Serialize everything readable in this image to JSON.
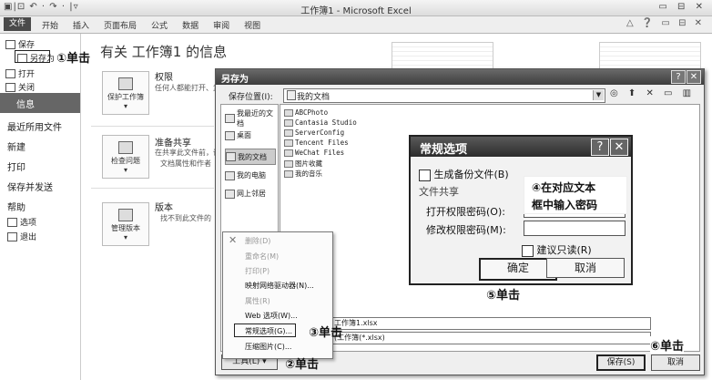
{
  "window": {
    "title": "工作簿1 - Microsoft Excel",
    "qat": "▣|⊡ ↶ · ↷ · |▿",
    "controls": "▭ ⊟ ✕"
  },
  "ribbon": {
    "file_tab": "文件",
    "tabs": [
      "开始",
      "插入",
      "页面布局",
      "公式",
      "数据",
      "审阅",
      "视图"
    ],
    "right_icons": "△ ❓ ▭ ⊟ ✕"
  },
  "backstage": {
    "items": {
      "save": "保存",
      "save_as": "另存为",
      "open": "打开",
      "close": "关闭",
      "info": "信息",
      "recent": "最近所用文件",
      "new": "新建",
      "print": "打印",
      "save_send": "保存并发送",
      "help": "帮助",
      "options": "选项",
      "exit": "退出"
    },
    "info_title": "有关 工作簿1 的信息",
    "sections": [
      {
        "button": "保护工作簿",
        "title": "权限",
        "text": "任何人都能打开、复"
      },
      {
        "button": "检查问题",
        "title": "准备共享",
        "text": "在共享此文件前，请",
        "text2": "文档属性和作者"
      },
      {
        "button": "管理版本",
        "title": "版本",
        "text": "找不到此文件的"
      }
    ]
  },
  "save_as": {
    "title": "另存为",
    "help_btn": "?",
    "close_btn": "✕",
    "location_label": "保存位置(I):",
    "location_value": "我的文档",
    "toolbar_icons": "◎ ⬆ ✕ ▭ ▥",
    "places": [
      "我最近的文档",
      "桌面",
      "我的文档",
      "我的电脑",
      "网上邻居"
    ],
    "files": [
      "ABCPhoto",
      "Cantasia Studio",
      "ServerConfig",
      "Tencent Files",
      "WeChat Files",
      "图片收藏",
      "我的音乐"
    ],
    "filename": "工作簿1.xlsx",
    "filetype": "(工作簿(*.xlsx)",
    "tools_label": "工具(L) ▾",
    "save_label": "保存(S)",
    "cancel_label": "取消"
  },
  "tools_menu": {
    "items": [
      "删除(D)",
      "重命名(M)",
      "打印(P)",
      "映射网络驱动器(N)...",
      "属性(R)",
      "Web 选项(W)...",
      "常规选项(G)...",
      "压缩图片(C)..."
    ],
    "delete_icon": "✕"
  },
  "general_options": {
    "title": "常规选项",
    "help_btn": "?",
    "close_btn": "✕",
    "backup_label": "生成备份文件(B)",
    "sharing_label": "文件共享",
    "open_pwd_label": "打开权限密码(O):",
    "modify_pwd_label": "修改权限密码(M):",
    "readonly_label": "建议只读(R)",
    "ok_label": "确定",
    "cancel_label": "取消"
  },
  "annotations": {
    "step1": "①单击",
    "step2": "②单击",
    "step3": "③单击",
    "step4_line1": "④在对应文本",
    "step4_line2": "框中输入密码",
    "step5": "⑤单击",
    "step6": "⑥单击"
  }
}
